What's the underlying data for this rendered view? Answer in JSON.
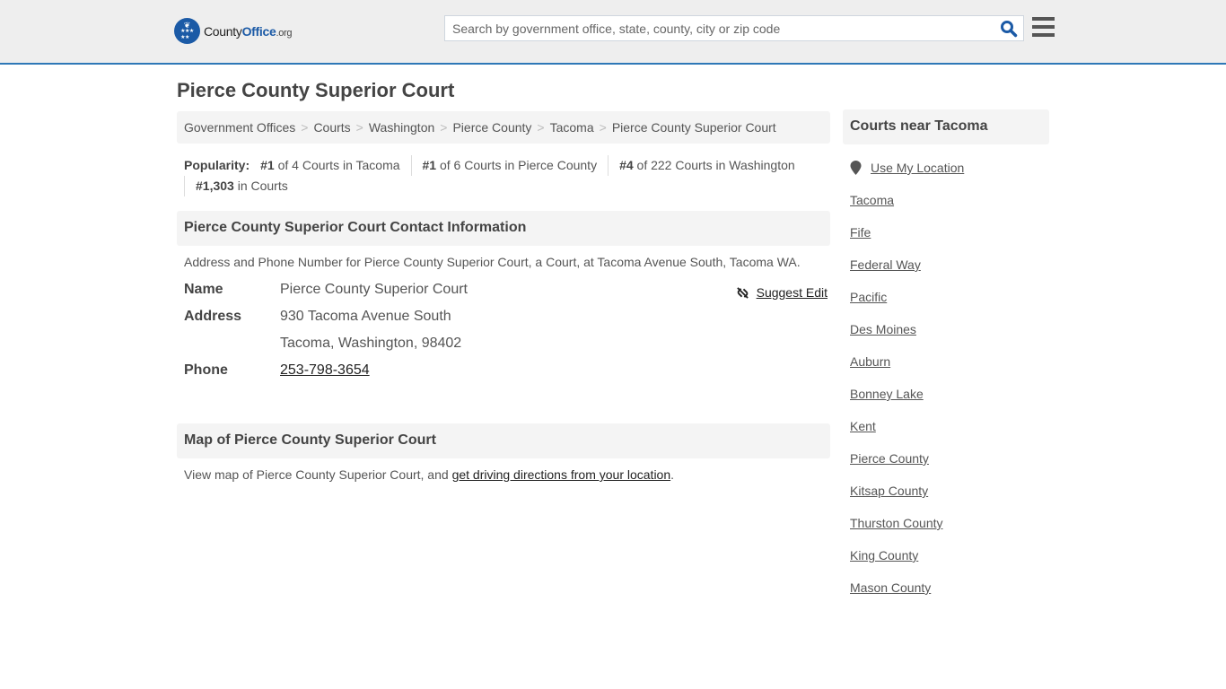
{
  "header": {
    "logo": {
      "county": "County",
      "office": "Office",
      "org": ".org"
    },
    "search": {
      "placeholder": "Search by government office, state, county, city or zip code",
      "value": ""
    }
  },
  "page_title": "Pierce County Superior Court",
  "breadcrumb": [
    "Government Offices",
    "Courts",
    "Washington",
    "Pierce County",
    "Tacoma",
    "Pierce County Superior Court"
  ],
  "popularity": {
    "label": "Popularity:",
    "items": [
      {
        "rank": "#1",
        "text": " of 4 Courts in Tacoma"
      },
      {
        "rank": "#1",
        "text": " of 6 Courts in Pierce County"
      },
      {
        "rank": "#4",
        "text": " of 222 Courts in Washington"
      },
      {
        "rank": "#1,303",
        "text": " in Courts"
      }
    ]
  },
  "contact": {
    "heading": "Pierce County Superior Court Contact Information",
    "description": "Address and Phone Number for Pierce County Superior Court, a Court, at Tacoma Avenue South, Tacoma WA.",
    "suggest_edit": "Suggest Edit",
    "name_label": "Name",
    "name_value": "Pierce County Superior Court",
    "address_label": "Address",
    "address_line1": "930 Tacoma Avenue South",
    "address_line2": "Tacoma, Washington, 98402",
    "phone_label": "Phone",
    "phone_value": "253-798-3654"
  },
  "map": {
    "heading": "Map of Pierce County Superior Court",
    "desc_prefix": "View map of Pierce County Superior Court, and ",
    "desc_link": "get driving directions from your location",
    "desc_suffix": "."
  },
  "sidebar": {
    "heading": "Courts near Tacoma",
    "use_location": "Use My Location",
    "links": [
      "Tacoma",
      "Fife",
      "Federal Way",
      "Pacific",
      "Des Moines",
      "Auburn",
      "Bonney Lake",
      "Kent",
      "Pierce County",
      "Kitsap County",
      "Thurston County",
      "King County",
      "Mason County"
    ]
  },
  "colors": {
    "brand_blue": "#1b5aa6",
    "header_border": "#2e78b7",
    "panel_bg": "#f4f4f4"
  }
}
